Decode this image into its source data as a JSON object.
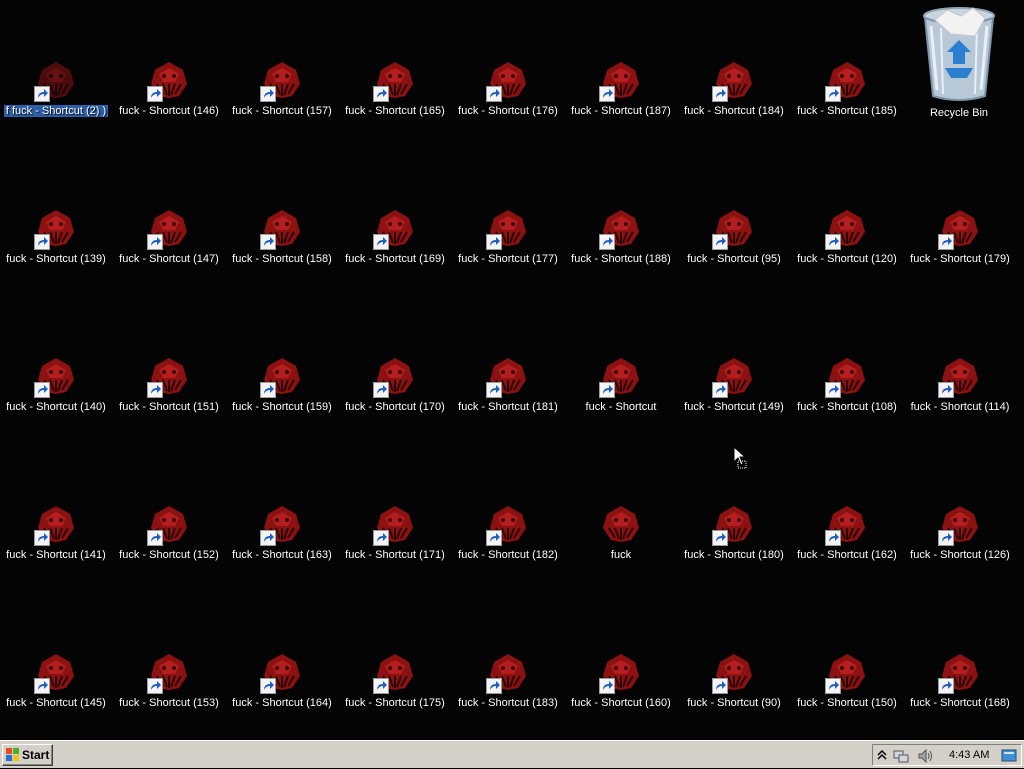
{
  "desktop": {
    "icons": [
      {
        "label": "f fuck - Shortcut (2) )",
        "shortcut": true,
        "selected": true
      },
      {
        "label": "fuck - Shortcut (146)",
        "shortcut": true
      },
      {
        "label": "fuck - Shortcut (157)",
        "shortcut": true
      },
      {
        "label": "fuck - Shortcut (165)",
        "shortcut": true
      },
      {
        "label": "fuck - Shortcut (176)",
        "shortcut": true
      },
      {
        "label": "fuck - Shortcut (187)",
        "shortcut": true
      },
      {
        "label": "fuck - Shortcut (184)",
        "shortcut": true
      },
      {
        "label": "fuck - Shortcut (185)",
        "shortcut": true
      },
      {
        "label": "fuck - Shortcut (139)",
        "shortcut": true
      },
      {
        "label": "fuck - Shortcut (147)",
        "shortcut": true
      },
      {
        "label": "fuck - Shortcut (158)",
        "shortcut": true
      },
      {
        "label": "fuck - Shortcut (169)",
        "shortcut": true
      },
      {
        "label": "fuck - Shortcut (177)",
        "shortcut": true
      },
      {
        "label": "fuck - Shortcut (188)",
        "shortcut": true
      },
      {
        "label": "fuck - Shortcut (95)",
        "shortcut": true
      },
      {
        "label": "fuck - Shortcut (120)",
        "shortcut": true
      },
      {
        "label": "fuck - Shortcut (179)",
        "shortcut": true
      },
      {
        "label": "fuck - Shortcut (140)",
        "shortcut": true
      },
      {
        "label": "fuck - Shortcut (151)",
        "shortcut": true
      },
      {
        "label": "fuck - Shortcut (159)",
        "shortcut": true
      },
      {
        "label": "fuck - Shortcut (170)",
        "shortcut": true
      },
      {
        "label": "fuck - Shortcut (181)",
        "shortcut": true
      },
      {
        "label": "fuck - Shortcut",
        "shortcut": true
      },
      {
        "label": "fuck - Shortcut (149)",
        "shortcut": true
      },
      {
        "label": "fuck - Shortcut (108)",
        "shortcut": true
      },
      {
        "label": "fuck - Shortcut (114)",
        "shortcut": true
      },
      {
        "label": "fuck - Shortcut (141)",
        "shortcut": true
      },
      {
        "label": "fuck - Shortcut (152)",
        "shortcut": true
      },
      {
        "label": "fuck - Shortcut (163)",
        "shortcut": true
      },
      {
        "label": "fuck - Shortcut (171)",
        "shortcut": true
      },
      {
        "label": "fuck - Shortcut (182)",
        "shortcut": true
      },
      {
        "label": "fuck",
        "shortcut": false
      },
      {
        "label": "fuck - Shortcut (180)",
        "shortcut": true
      },
      {
        "label": "fuck - Shortcut (162)",
        "shortcut": true
      },
      {
        "label": "fuck - Shortcut (126)",
        "shortcut": true
      },
      {
        "label": "fuck - Shortcut (145)",
        "shortcut": true
      },
      {
        "label": "fuck - Shortcut (153)",
        "shortcut": true
      },
      {
        "label": "fuck - Shortcut (164)",
        "shortcut": true
      },
      {
        "label": "fuck - Shortcut (175)",
        "shortcut": true
      },
      {
        "label": "fuck - Shortcut (183)",
        "shortcut": true
      },
      {
        "label": "fuck - Shortcut (160)",
        "shortcut": true
      },
      {
        "label": "fuck - Shortcut (90)",
        "shortcut": true
      },
      {
        "label": "fuck - Shortcut (150)",
        "shortcut": true
      },
      {
        "label": "fuck - Shortcut (168)",
        "shortcut": true
      }
    ],
    "recycle_bin": {
      "label": "Recycle Bin",
      "icon": "recycle-bin-icon"
    }
  },
  "taskbar": {
    "start_label": "Start",
    "clock": "4:43 AM",
    "tray_icons": [
      "show-hidden-icons-icon",
      "network-icon",
      "volume-icon",
      "action-center-icon"
    ]
  },
  "colors": {
    "desktop_bg": "#040404",
    "taskbar_bg": "#d4d0c8",
    "selection": "#2c5fa8",
    "icon_red": "#9c1616"
  }
}
